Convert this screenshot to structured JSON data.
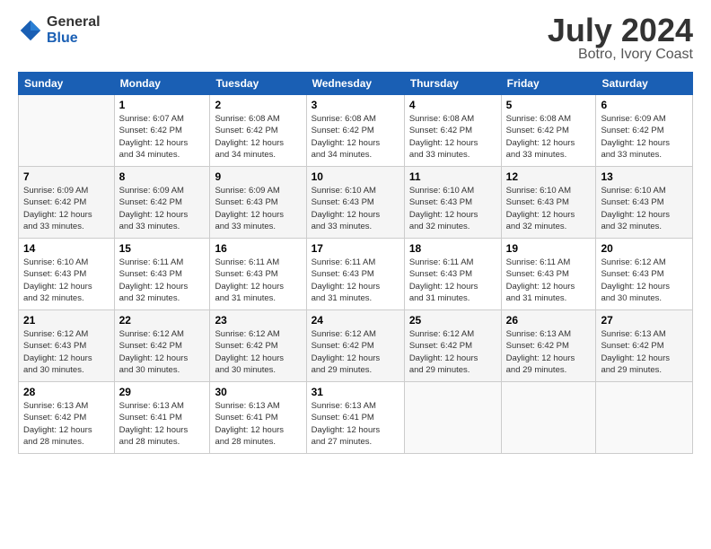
{
  "header": {
    "logo": {
      "general": "General",
      "blue": "Blue"
    },
    "title": "July 2024",
    "subtitle": "Botro, Ivory Coast"
  },
  "days_of_week": [
    "Sunday",
    "Monday",
    "Tuesday",
    "Wednesday",
    "Thursday",
    "Friday",
    "Saturday"
  ],
  "weeks": [
    [
      {
        "num": "",
        "info": ""
      },
      {
        "num": "1",
        "info": "Sunrise: 6:07 AM\nSunset: 6:42 PM\nDaylight: 12 hours\nand 34 minutes."
      },
      {
        "num": "2",
        "info": "Sunrise: 6:08 AM\nSunset: 6:42 PM\nDaylight: 12 hours\nand 34 minutes."
      },
      {
        "num": "3",
        "info": "Sunrise: 6:08 AM\nSunset: 6:42 PM\nDaylight: 12 hours\nand 34 minutes."
      },
      {
        "num": "4",
        "info": "Sunrise: 6:08 AM\nSunset: 6:42 PM\nDaylight: 12 hours\nand 33 minutes."
      },
      {
        "num": "5",
        "info": "Sunrise: 6:08 AM\nSunset: 6:42 PM\nDaylight: 12 hours\nand 33 minutes."
      },
      {
        "num": "6",
        "info": "Sunrise: 6:09 AM\nSunset: 6:42 PM\nDaylight: 12 hours\nand 33 minutes."
      }
    ],
    [
      {
        "num": "7",
        "info": "Sunrise: 6:09 AM\nSunset: 6:42 PM\nDaylight: 12 hours\nand 33 minutes."
      },
      {
        "num": "8",
        "info": "Sunrise: 6:09 AM\nSunset: 6:42 PM\nDaylight: 12 hours\nand 33 minutes."
      },
      {
        "num": "9",
        "info": "Sunrise: 6:09 AM\nSunset: 6:43 PM\nDaylight: 12 hours\nand 33 minutes."
      },
      {
        "num": "10",
        "info": "Sunrise: 6:10 AM\nSunset: 6:43 PM\nDaylight: 12 hours\nand 33 minutes."
      },
      {
        "num": "11",
        "info": "Sunrise: 6:10 AM\nSunset: 6:43 PM\nDaylight: 12 hours\nand 32 minutes."
      },
      {
        "num": "12",
        "info": "Sunrise: 6:10 AM\nSunset: 6:43 PM\nDaylight: 12 hours\nand 32 minutes."
      },
      {
        "num": "13",
        "info": "Sunrise: 6:10 AM\nSunset: 6:43 PM\nDaylight: 12 hours\nand 32 minutes."
      }
    ],
    [
      {
        "num": "14",
        "info": "Sunrise: 6:10 AM\nSunset: 6:43 PM\nDaylight: 12 hours\nand 32 minutes."
      },
      {
        "num": "15",
        "info": "Sunrise: 6:11 AM\nSunset: 6:43 PM\nDaylight: 12 hours\nand 32 minutes."
      },
      {
        "num": "16",
        "info": "Sunrise: 6:11 AM\nSunset: 6:43 PM\nDaylight: 12 hours\nand 31 minutes."
      },
      {
        "num": "17",
        "info": "Sunrise: 6:11 AM\nSunset: 6:43 PM\nDaylight: 12 hours\nand 31 minutes."
      },
      {
        "num": "18",
        "info": "Sunrise: 6:11 AM\nSunset: 6:43 PM\nDaylight: 12 hours\nand 31 minutes."
      },
      {
        "num": "19",
        "info": "Sunrise: 6:11 AM\nSunset: 6:43 PM\nDaylight: 12 hours\nand 31 minutes."
      },
      {
        "num": "20",
        "info": "Sunrise: 6:12 AM\nSunset: 6:43 PM\nDaylight: 12 hours\nand 30 minutes."
      }
    ],
    [
      {
        "num": "21",
        "info": "Sunrise: 6:12 AM\nSunset: 6:43 PM\nDaylight: 12 hours\nand 30 minutes."
      },
      {
        "num": "22",
        "info": "Sunrise: 6:12 AM\nSunset: 6:42 PM\nDaylight: 12 hours\nand 30 minutes."
      },
      {
        "num": "23",
        "info": "Sunrise: 6:12 AM\nSunset: 6:42 PM\nDaylight: 12 hours\nand 30 minutes."
      },
      {
        "num": "24",
        "info": "Sunrise: 6:12 AM\nSunset: 6:42 PM\nDaylight: 12 hours\nand 29 minutes."
      },
      {
        "num": "25",
        "info": "Sunrise: 6:12 AM\nSunset: 6:42 PM\nDaylight: 12 hours\nand 29 minutes."
      },
      {
        "num": "26",
        "info": "Sunrise: 6:13 AM\nSunset: 6:42 PM\nDaylight: 12 hours\nand 29 minutes."
      },
      {
        "num": "27",
        "info": "Sunrise: 6:13 AM\nSunset: 6:42 PM\nDaylight: 12 hours\nand 29 minutes."
      }
    ],
    [
      {
        "num": "28",
        "info": "Sunrise: 6:13 AM\nSunset: 6:42 PM\nDaylight: 12 hours\nand 28 minutes."
      },
      {
        "num": "29",
        "info": "Sunrise: 6:13 AM\nSunset: 6:41 PM\nDaylight: 12 hours\nand 28 minutes."
      },
      {
        "num": "30",
        "info": "Sunrise: 6:13 AM\nSunset: 6:41 PM\nDaylight: 12 hours\nand 28 minutes."
      },
      {
        "num": "31",
        "info": "Sunrise: 6:13 AM\nSunset: 6:41 PM\nDaylight: 12 hours\nand 27 minutes."
      },
      {
        "num": "",
        "info": ""
      },
      {
        "num": "",
        "info": ""
      },
      {
        "num": "",
        "info": ""
      }
    ]
  ]
}
